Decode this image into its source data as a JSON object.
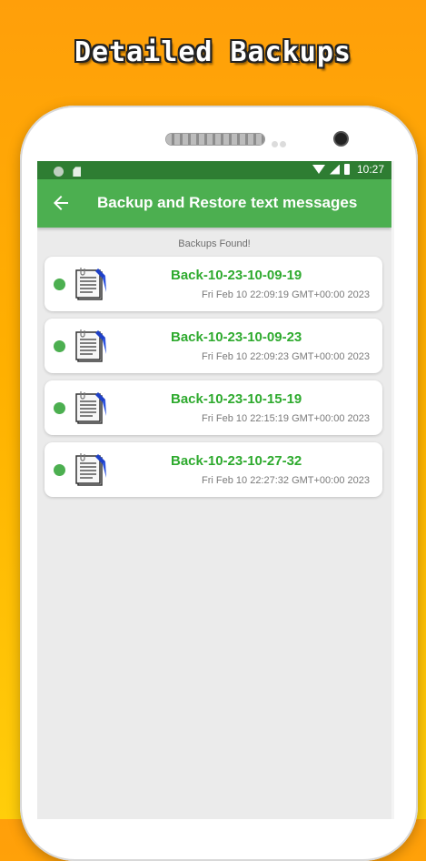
{
  "promo": {
    "headline": "Detailed Backups"
  },
  "status_bar": {
    "time": "10:27"
  },
  "app_bar": {
    "title": "Backup and Restore text messages"
  },
  "content": {
    "section_label": "Backups Found!",
    "backups": [
      {
        "name": "Back-10-23-10-09-19",
        "date": "Fri Feb 10 22:09:19 GMT+00:00 2023"
      },
      {
        "name": "Back-10-23-10-09-23",
        "date": "Fri Feb 10 22:09:23 GMT+00:00 2023"
      },
      {
        "name": "Back-10-23-10-15-19",
        "date": "Fri Feb 10 22:15:19 GMT+00:00 2023"
      },
      {
        "name": "Back-10-23-10-27-32",
        "date": "Fri Feb 10 22:27:32 GMT+00:00 2023"
      }
    ]
  },
  "icons": {
    "back": "arrow-left-icon",
    "backup_item": "document-pencil-icon",
    "status_dot": "green-dot-icon"
  },
  "colors": {
    "status_bar": "#2e7d32",
    "app_bar": "#4caf50",
    "backup_name": "#2eaa2e",
    "screen_background": "#ebebeb",
    "background_top": "#ff9f0a",
    "background_bottom": "#ffce0a"
  }
}
